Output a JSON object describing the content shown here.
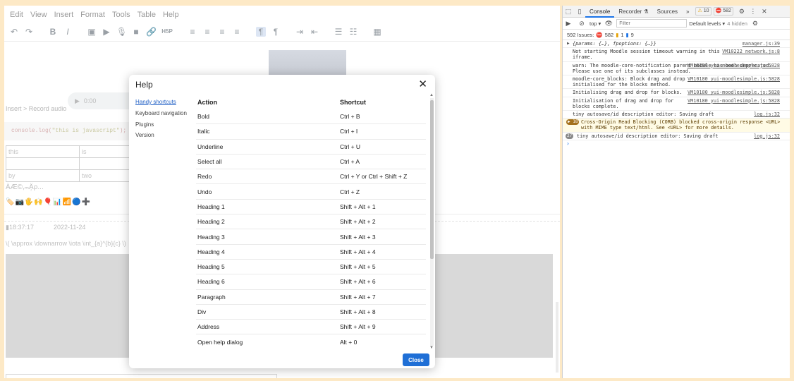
{
  "menubar": {
    "items": [
      "Edit",
      "View",
      "Insert",
      "Format",
      "Tools",
      "Table",
      "Help"
    ]
  },
  "toolbar": {
    "icons": [
      "undo-icon",
      "redo-icon",
      "bold-icon",
      "italic-icon",
      "image-icon",
      "media-icon",
      "mic-icon",
      "video-icon",
      "link-icon",
      "h5p-icon",
      "align-left-icon",
      "align-center-icon",
      "align-right-icon",
      "align-justify-icon",
      "ltr-icon",
      "rtl-icon",
      "indent-icon",
      "outdent-icon",
      "bullet-list-icon",
      "numbered-list-icon",
      "table-icon"
    ],
    "h5p_label": "H5P"
  },
  "editor": {
    "audio_time": "0:00",
    "insert_record_audio": "Insert > Record audio",
    "code_fn": "console.log(",
    "code_str": "\"this is javascript\"",
    "code_end": ");",
    "table": [
      [
        "this",
        "is"
      ],
      [
        "",
        ""
      ],
      [
        "by",
        "two"
      ]
    ],
    "special_chars": "ÀÆ©,ₘÄ᷊ρ...",
    "emoji_row": "🏷️📷🖐️🙌🎈📊📶🔵➕",
    "time": "18:37:17",
    "date": "2022-11-24",
    "math": "\\( \\approx \\downarrow \\iota \\int_{a}^{b}{c} \\)"
  },
  "dialog": {
    "title": "Help",
    "nav": [
      "Handy shortcuts",
      "Keyboard navigation",
      "Plugins",
      "Version"
    ],
    "col_action": "Action",
    "col_shortcut": "Shortcut",
    "rows": [
      {
        "action": "Bold",
        "shortcut": "Ctrl + B"
      },
      {
        "action": "Italic",
        "shortcut": "Ctrl + I"
      },
      {
        "action": "Underline",
        "shortcut": "Ctrl + U"
      },
      {
        "action": "Select all",
        "shortcut": "Ctrl + A"
      },
      {
        "action": "Redo",
        "shortcut": "Ctrl + Y or Ctrl + Shift + Z"
      },
      {
        "action": "Undo",
        "shortcut": "Ctrl + Z"
      },
      {
        "action": "Heading 1",
        "shortcut": "Shift + Alt + 1"
      },
      {
        "action": "Heading 2",
        "shortcut": "Shift + Alt + 2"
      },
      {
        "action": "Heading 3",
        "shortcut": "Shift + Alt + 3"
      },
      {
        "action": "Heading 4",
        "shortcut": "Shift + Alt + 4"
      },
      {
        "action": "Heading 5",
        "shortcut": "Shift + Alt + 5"
      },
      {
        "action": "Heading 6",
        "shortcut": "Shift + Alt + 6"
      },
      {
        "action": "Paragraph",
        "shortcut": "Shift + Alt + 7"
      },
      {
        "action": "Div",
        "shortcut": "Shift + Alt + 8"
      },
      {
        "action": "Address",
        "shortcut": "Shift + Alt + 9"
      },
      {
        "action": "Open help dialog",
        "shortcut": "Alt + 0"
      }
    ],
    "close_label": "Close"
  },
  "devtools": {
    "tabs": [
      "Console",
      "Recorder",
      "Sources"
    ],
    "more": "»",
    "warn_count": "10",
    "error_count": "582",
    "context": "top",
    "filter_placeholder": "Filter",
    "levels": "Default levels",
    "hidden": "4 hidden",
    "issues_label": "592 Issues:",
    "issues_errors": "582",
    "issues_warn": "1",
    "issues_info": "9",
    "logs": [
      {
        "text": "{params: {…}, fpoptions: {…}}",
        "src": "manager.js:39",
        "type": "obj"
      },
      {
        "text": "Not starting Moodle session timeout warning in this iframe.",
        "src": "VM10222 network.js:8",
        "type": "log"
      },
      {
        "text": "warn: The moodle-core-notification parent module has been deprecated. Please use one of its subclasses instead.",
        "src": "VM10180 yui-moodlesimple.js:5828",
        "type": "log"
      },
      {
        "text": "moodle-core_blocks: Block drag and drop initialised for the blocks method.",
        "src": "VM10180 yui-moodlesimple.js:5828",
        "type": "log"
      },
      {
        "text": "Initialising drag and drop for blocks.",
        "src": "VM10180 yui-moodlesimple.js:5828",
        "type": "log"
      },
      {
        "text": "Initialisation of drag and drop for blocks complete.",
        "src": "VM10180 yui-moodlesimple.js:5828",
        "type": "log"
      },
      {
        "text": "tiny autosave/id description editor: Saving draft",
        "src": "log.js:32",
        "type": "log"
      },
      {
        "text": "Cross-Origin Read Blocking (CORB) blocked cross-origin response <URL> with MIME type text/html. See <URL> for more details.",
        "src": "",
        "type": "warn",
        "count": "18"
      },
      {
        "text": "tiny autosave/id description editor: Saving draft",
        "src": "log.js:32",
        "type": "grouped",
        "count": "27"
      }
    ],
    "prompt": "›"
  },
  "colors": {
    "accent": "#1f6fd6",
    "page_bg": "#fde9c6"
  }
}
